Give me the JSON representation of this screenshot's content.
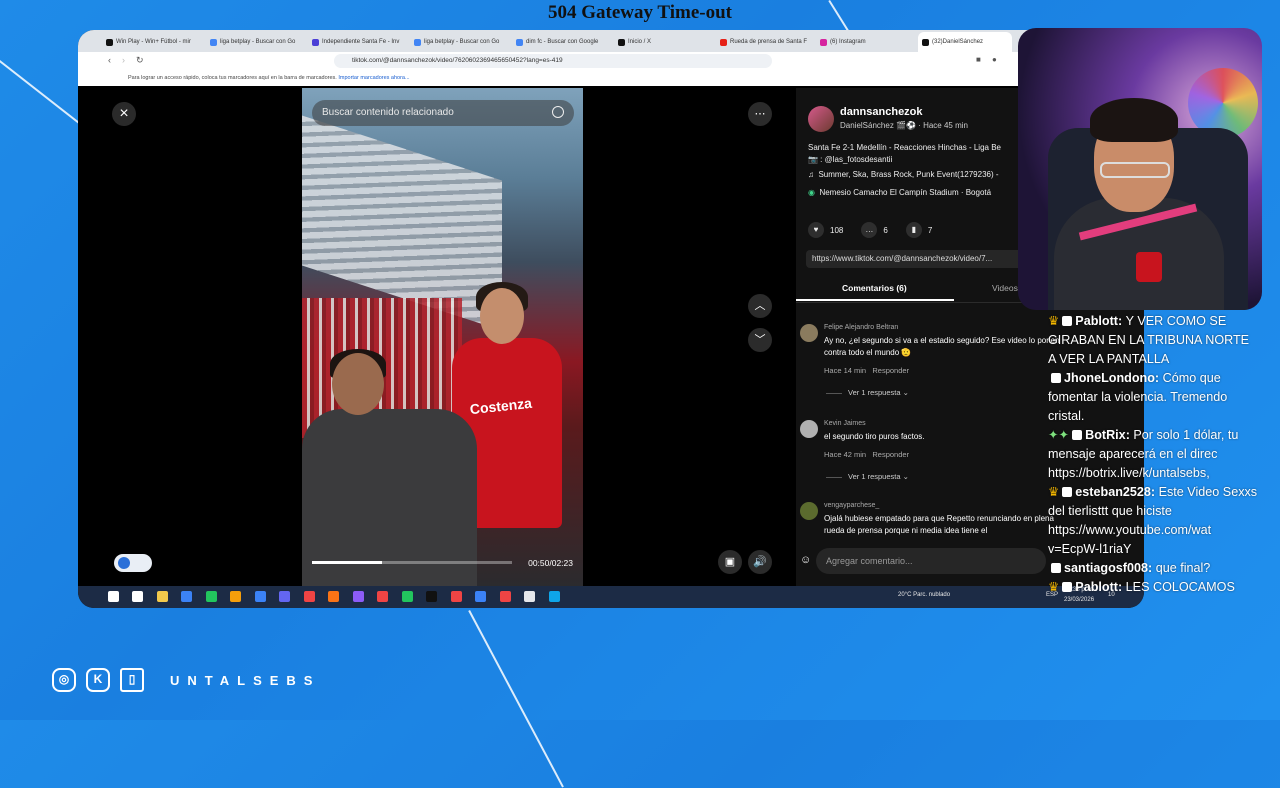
{
  "page": {
    "title": "504 Gateway Time-out"
  },
  "browser": {
    "tabs": [
      {
        "label": "Win Play - Win+ Fútbol - mir",
        "fav": "#111111"
      },
      {
        "label": "liga betplay - Buscar con Go",
        "fav": "#4285f4"
      },
      {
        "label": "Independiente Santa Fe - Inv",
        "fav": "#4b3fd6"
      },
      {
        "label": "liga betplay - Buscar con Go",
        "fav": "#4285f4"
      },
      {
        "label": "dim fc - Buscar con Google",
        "fav": "#4285f4"
      },
      {
        "label": "Inicio / X",
        "fav": "#111111"
      },
      {
        "label": "Rueda de prensa de Santa F",
        "fav": "#e62117"
      },
      {
        "label": "(6) Instagram",
        "fav": "#d6249f"
      },
      {
        "label": "(32)DanielSánchez",
        "fav": "#111111"
      }
    ],
    "url": "tiktok.com/@dannsanchezok/video/7620602369465650452?lang=es-419",
    "bookmarks_hint": "Para lograr un acceso rápido, coloca tus marcadores aquí en la barra de marcadores.",
    "bookmarks_link": "Importar marcadores ahora..."
  },
  "tiktok": {
    "search_placeholder": "Buscar contenido relacionado",
    "video": {
      "time": "00:50/02:23",
      "progress": 0.35,
      "scarf_text": "Costenza"
    },
    "author": {
      "username": "dannsanchezok",
      "display": "DanielSánchez 🎬⚽ · Hace 45 min"
    },
    "description": "Santa Fe 2-1 Medellín - Reacciones Hinchas - Liga Be",
    "photo_credit": "📷 : @las_fotosdesantii",
    "music": "Summer, Ska, Brass Rock, Punk Event(1279236) -",
    "location": "Nemesio Camacho El Campín Stadium · Bogotá",
    "stats": {
      "likes": "108",
      "comments": "6",
      "saves": "7"
    },
    "link": "https://www.tiktok.com/@dannsanchezok/video/7...",
    "tab_comments": "Comentarios (6)",
    "tab_videos": "Videos",
    "comments": [
      {
        "author": "Felipe Alejandro Beltran",
        "text": "Ay no, ¿el segundo si va a el estadio seguido? Ese video lo ponen contra todo el mundo 🫡",
        "time": "Hace 14 min",
        "reply": "Responder",
        "replies": "Ver 1 respuesta"
      },
      {
        "author": "Kevin Jaimes",
        "text": "el segundo tiro puros factos.",
        "time": "Hace 42 min",
        "reply": "Responder",
        "replies": "Ver 1 respuesta"
      },
      {
        "author": "vengayparchese_",
        "text": "Ojalá hubiese empatado para que Repetto renunciando en plena rueda de prensa porque ni media idea tiene el"
      }
    ],
    "comment_placeholder": "Agregar comentario..."
  },
  "taskbar": {
    "weather": "20°C  Parc. nublado",
    "lang": "ESP",
    "time": "7:38 p. m.",
    "date": "23/03/2026",
    "notif": "10"
  },
  "chat": [
    {
      "badge": "crown",
      "user": "Pablott",
      "msg": "Y VER COMO SE GIRABAN EN LA TRIBUNA NORTE A VER LA PANTALLA",
      "color": "#ffffff"
    },
    {
      "badge": "",
      "user": "JhoneLondono",
      "msg": "Cómo que fomentar la violencia. Tremendo cristal.",
      "color": "#ffffff"
    },
    {
      "badge": "bot",
      "user": "BotRix",
      "msg": "Por solo 1 dólar, tu mensaje aparecerá en el direc https://botrix.live/k/untalsebs,",
      "color": "#ffffff"
    },
    {
      "badge": "crown",
      "user": "esteban2528",
      "msg": "Este Video Sexxs del tierlisttt que hiciste https://www.youtube.com/wat v=EcpW-l1riaY",
      "color": "#ffffff"
    },
    {
      "badge": "",
      "user": "santiagosf008",
      "msg": "que final?",
      "color": "#ffffff"
    },
    {
      "badge": "crown",
      "user": "Pablott",
      "msg": "LES COLOCAMOS",
      "color": "#ffffff"
    }
  ],
  "branding": {
    "handle": "UNTALSEBS"
  }
}
